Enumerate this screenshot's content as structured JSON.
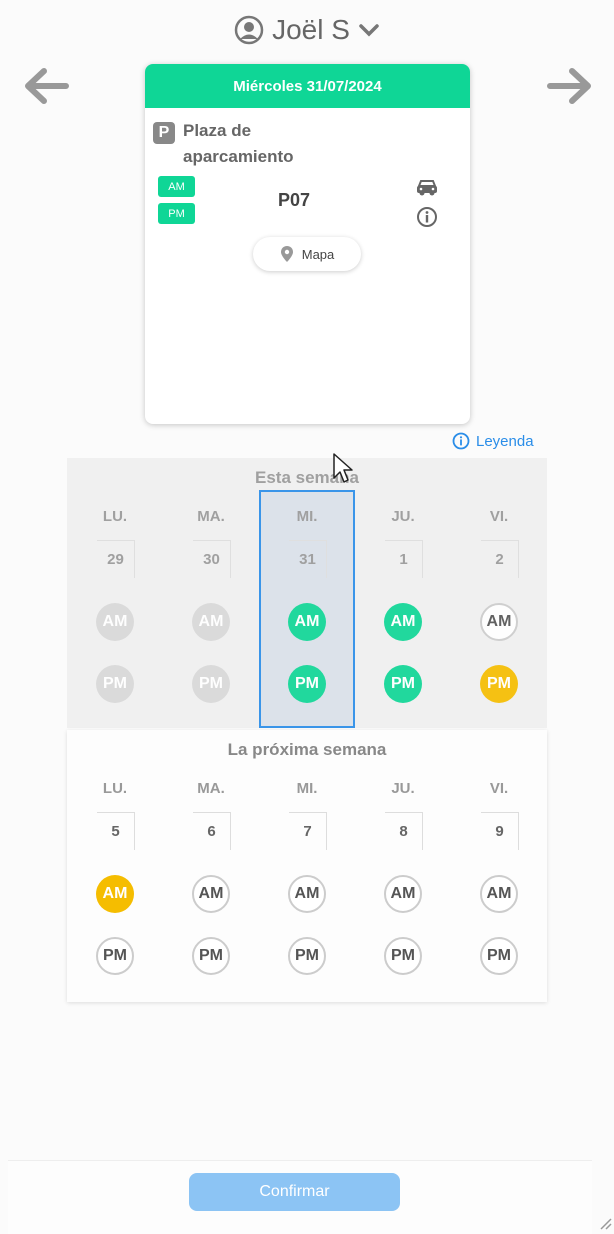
{
  "user": {
    "name": "Joël S",
    "icon": "user-circle-icon"
  },
  "reservation": {
    "date": "Miércoles 31/07/2024",
    "type_badge": "P",
    "type_label": "Plaza de aparcamiento",
    "chips": [
      "AM",
      "PM"
    ],
    "spot": "P07",
    "map_label": "Mapa",
    "colors": {
      "header": "#0fd696"
    }
  },
  "legend_label": "Leyenda",
  "this_week": {
    "title": "Esta semana",
    "days": [
      {
        "name": "LU.",
        "date": "29",
        "am": "AM",
        "pm": "PM"
      },
      {
        "name": "MA.",
        "date": "30",
        "am": "AM",
        "pm": "PM"
      },
      {
        "name": "MI.",
        "date": "31",
        "am": "AM",
        "pm": "PM"
      },
      {
        "name": "JU.",
        "date": "1",
        "am": "AM",
        "pm": "PM"
      },
      {
        "name": "VI.",
        "date": "2",
        "am": "AM",
        "pm": "PM"
      }
    ]
  },
  "next_week": {
    "title": "La próxima semana",
    "days": [
      {
        "name": "LU.",
        "date": "5",
        "am": "AM",
        "pm": "PM"
      },
      {
        "name": "MA.",
        "date": "6",
        "am": "AM",
        "pm": "PM"
      },
      {
        "name": "MI.",
        "date": "7",
        "am": "AM",
        "pm": "PM"
      },
      {
        "name": "JU.",
        "date": "8",
        "am": "AM",
        "pm": "PM"
      },
      {
        "name": "VI.",
        "date": "9",
        "am": "AM",
        "pm": "PM"
      }
    ]
  },
  "confirm_label": "Confirmar",
  "status_colors": {
    "booked": "#0fd696",
    "pending": "#f5bd00",
    "past": "#d8d8d8",
    "selected": "#2a8de8"
  }
}
